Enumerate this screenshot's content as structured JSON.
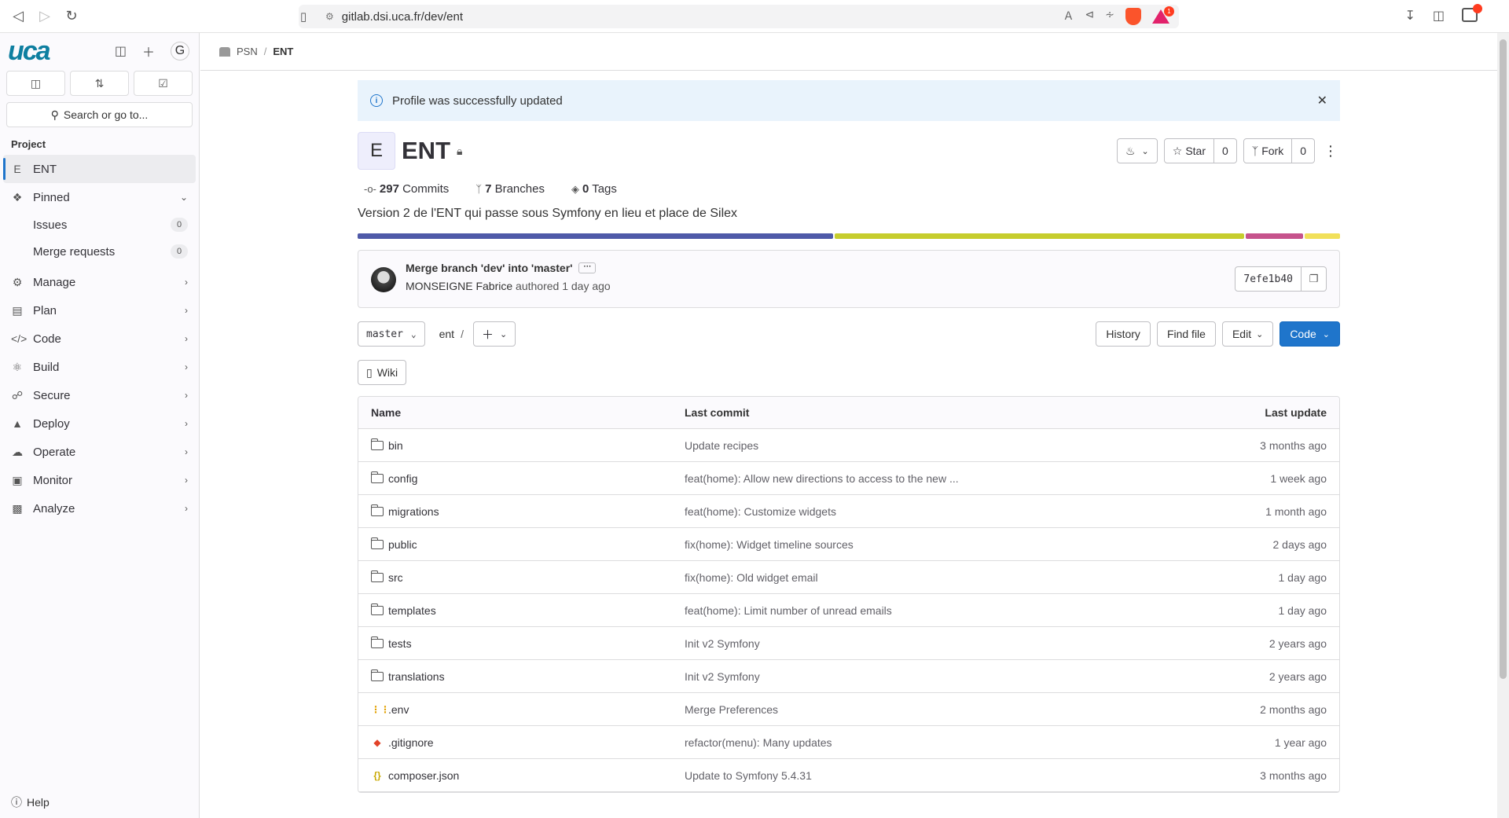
{
  "browser": {
    "url": "gitlab.dsi.uca.fr/dev/ent",
    "rewards_count": "1"
  },
  "sidebar": {
    "logo": "uca",
    "avatar_letter": "G",
    "search_label": "Search or go to...",
    "section_label": "Project",
    "project_letter": "E",
    "project_name": "ENT",
    "pinned_label": "Pinned",
    "pinned_items": [
      {
        "label": "Issues",
        "count": "0"
      },
      {
        "label": "Merge requests",
        "count": "0"
      }
    ],
    "nav_items": [
      {
        "label": "Manage",
        "icon": "users-icon"
      },
      {
        "label": "Plan",
        "icon": "plan-icon"
      },
      {
        "label": "Code",
        "icon": "code-icon"
      },
      {
        "label": "Build",
        "icon": "rocket-icon"
      },
      {
        "label": "Secure",
        "icon": "shield-icon"
      },
      {
        "label": "Deploy",
        "icon": "deploy-icon"
      },
      {
        "label": "Operate",
        "icon": "cloud-icon"
      },
      {
        "label": "Monitor",
        "icon": "monitor-icon"
      },
      {
        "label": "Analyze",
        "icon": "chart-icon"
      }
    ],
    "help_label": "Help"
  },
  "breadcrumb": {
    "group": "PSN",
    "project": "ENT"
  },
  "alert": {
    "message": "Profile was successfully updated"
  },
  "project": {
    "avatar_letter": "E",
    "name": "ENT",
    "star_label": "Star",
    "star_count": "0",
    "fork_label": "Fork",
    "fork_count": "0",
    "commits_count": "297",
    "commits_label": "Commits",
    "branches_count": "7",
    "branches_label": "Branches",
    "tags_count": "0",
    "tags_label": "Tags",
    "description": "Version 2 de l'ENT qui passe sous Symfony en lieu et place de Silex",
    "languages": [
      {
        "share": 48.6,
        "color": "#4f5aa8"
      },
      {
        "share": 41.9,
        "color": "#c6cd2d"
      },
      {
        "share": 5.9,
        "color": "#c6538c"
      },
      {
        "share": 3.6,
        "color": "#f1e05a"
      }
    ]
  },
  "last_commit": {
    "title": "Merge branch 'dev' into 'master'",
    "author": "MONSEIGNE Fabrice",
    "authored_text": "authored 1 day ago",
    "sha": "7efe1b40"
  },
  "tree": {
    "branch": "master",
    "path": "ent",
    "history_label": "History",
    "find_file_label": "Find file",
    "edit_label": "Edit",
    "code_label": "Code",
    "wiki_label": "Wiki",
    "headers": {
      "name": "Name",
      "commit": "Last commit",
      "date": "Last update"
    },
    "rows": [
      {
        "name": "bin",
        "type": "folder",
        "commit": "Update recipes",
        "date": "3 months ago"
      },
      {
        "name": "config",
        "type": "folder",
        "commit": "feat(home): Allow new directions to access to the new ...",
        "date": "1 week ago"
      },
      {
        "name": "migrations",
        "type": "folder",
        "commit": "feat(home): Customize widgets",
        "date": "1 month ago"
      },
      {
        "name": "public",
        "type": "folder",
        "commit": "fix(home): Widget timeline sources",
        "date": "2 days ago"
      },
      {
        "name": "src",
        "type": "folder",
        "commit": "fix(home): Old widget email",
        "date": "1 day ago"
      },
      {
        "name": "templates",
        "type": "folder",
        "commit": "feat(home): Limit number of unread emails",
        "date": "1 day ago"
      },
      {
        "name": "tests",
        "type": "folder",
        "commit": "Init v2 Symfony",
        "date": "2 years ago"
      },
      {
        "name": "translations",
        "type": "folder",
        "commit": "Init v2 Symfony",
        "date": "2 years ago"
      },
      {
        "name": ".env",
        "type": "env",
        "commit": "Merge Preferences",
        "date": "2 months ago"
      },
      {
        "name": ".gitignore",
        "type": "git",
        "commit": "refactor(menu): Many updates",
        "date": "1 year ago"
      },
      {
        "name": "composer.json",
        "type": "json",
        "commit": "Update to Symfony 5.4.31",
        "date": "3 months ago"
      }
    ]
  }
}
